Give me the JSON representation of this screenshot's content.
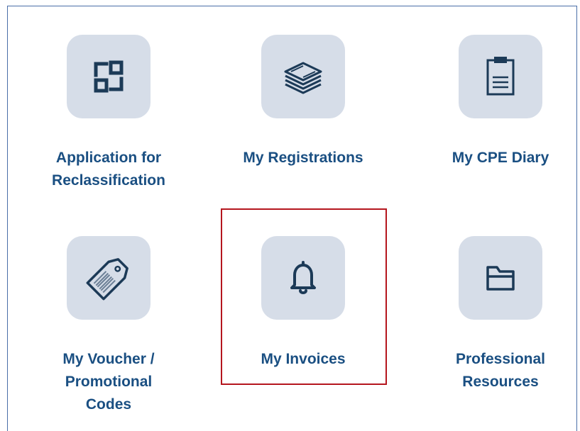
{
  "tiles": [
    {
      "label": "Application for\nReclassification",
      "icon": "reclassification-icon"
    },
    {
      "label": "My Registrations",
      "icon": "layers-stack-icon"
    },
    {
      "label": "My CPE Diary",
      "icon": "clipboard-icon"
    },
    {
      "label": "My Voucher /\nPromotional\nCodes",
      "icon": "tag-icon"
    },
    {
      "label": "My Invoices",
      "icon": "bell-icon"
    },
    {
      "label": "Professional\nResources",
      "icon": "folder-icon"
    }
  ],
  "colors": {
    "icon_tile_background": "#d6dde8",
    "icon_stroke": "#1c3a57",
    "label_text": "#1a4f82",
    "frame_border": "#4a6ea8",
    "highlight_border": "#b5161e"
  }
}
